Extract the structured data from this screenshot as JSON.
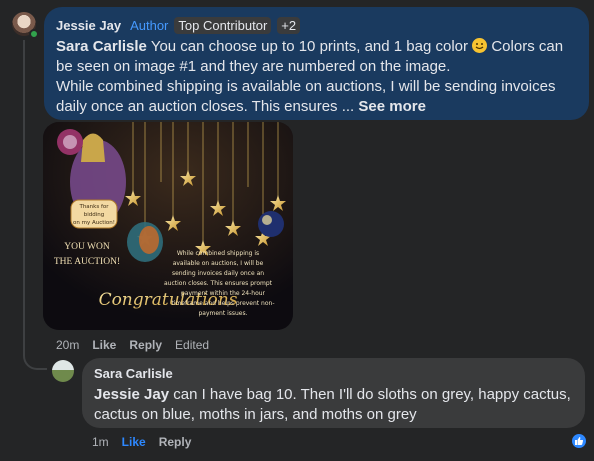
{
  "comment1": {
    "author": "Jessie Jay",
    "badge_author": "Author",
    "badge_top": "Top Contributor",
    "badge_more": "+2",
    "mention": "Sara Carlisle",
    "text_line1": "You can choose up to 10 prints, and 1 bag color",
    "text_line1b": "Colors can be seen on image #1 and they are numbered on the image.",
    "text_line2": "While combined shipping is available on auctions, I will be sending invoices daily once an auction closes. This ensures ... ",
    "see_more": "See more",
    "time": "20m",
    "like": "Like",
    "reply": "Reply",
    "edited": "Edited"
  },
  "attachment": {
    "thanks_line1": "Thanks for",
    "thanks_line2": "bidding",
    "thanks_line3": "on my Auction!",
    "won_line1": "YOU WON",
    "won_line2": "THE AUCTION!",
    "congrats": "Congratulations",
    "info_line1": "While combined shipping is",
    "info_line2": "available on auctions, I will be",
    "info_line3": "sending invoices daily once an",
    "info_line4": "auction closes. This ensures prompt",
    "info_line5": "payment within the 24-hour",
    "info_line6": "timeframe and helps prevent non-",
    "info_line7": "payment issues."
  },
  "comment2": {
    "author": "Sara Carlisle",
    "mention": "Jessie Jay",
    "text": "can I have bag 10. Then I'll do sloths on grey, happy cactus, cactus on blue, moths in jars, and moths on grey",
    "time": "1m",
    "like": "Like",
    "reply": "Reply"
  },
  "colors": {
    "background": "#242526",
    "bubble_author": "#1a3a5f",
    "bubble": "#3a3b3c",
    "link_blue": "#2d88ff"
  }
}
